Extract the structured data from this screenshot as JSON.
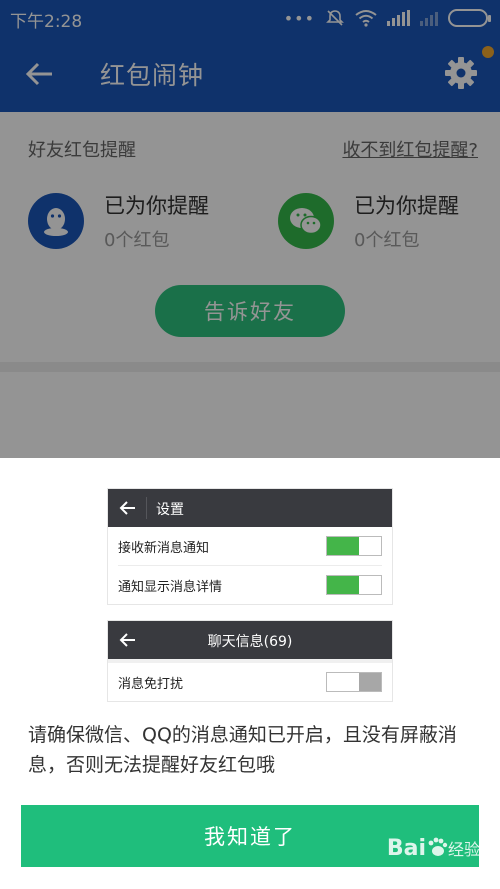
{
  "status_bar": {
    "time": "下午2:28",
    "dots": "•••"
  },
  "app_bar": {
    "title": "红包闹钟",
    "back_icon": "arrow-left-icon",
    "settings_icon": "gear-icon"
  },
  "reminders": {
    "section_label": "好友红包提醒",
    "help_link": "收不到红包提醒?",
    "accounts": [
      {
        "icon": "qq-penguin-icon",
        "status": "已为你提醒",
        "count": "0个红包"
      },
      {
        "icon": "wechat-icon",
        "status": "已为你提醒",
        "count": "0个红包"
      }
    ],
    "tell_friends_label": "告诉好友"
  },
  "guide": {
    "settings_panel": {
      "title": "设置",
      "rows": [
        {
          "label": "接收新消息通知",
          "toggle": "on"
        },
        {
          "label": "通知显示消息详情",
          "toggle": "on"
        }
      ]
    },
    "chat_panel": {
      "title": "聊天信息(69)",
      "rows": [
        {
          "label": "消息免打扰",
          "toggle": "off"
        }
      ]
    },
    "message": "请确保微信、QQ的消息通知已开启，且没有屏蔽消息，否则无法提醒好友红包哦",
    "ok_label": "我知道了"
  },
  "watermark": {
    "brand": "Bai",
    "suffix": "经验"
  },
  "colors": {
    "primary_blue": "#1a56b8",
    "green": "#1fbe7c",
    "wechat_green": "#35b84a",
    "notify_dot": "#f0a830"
  }
}
